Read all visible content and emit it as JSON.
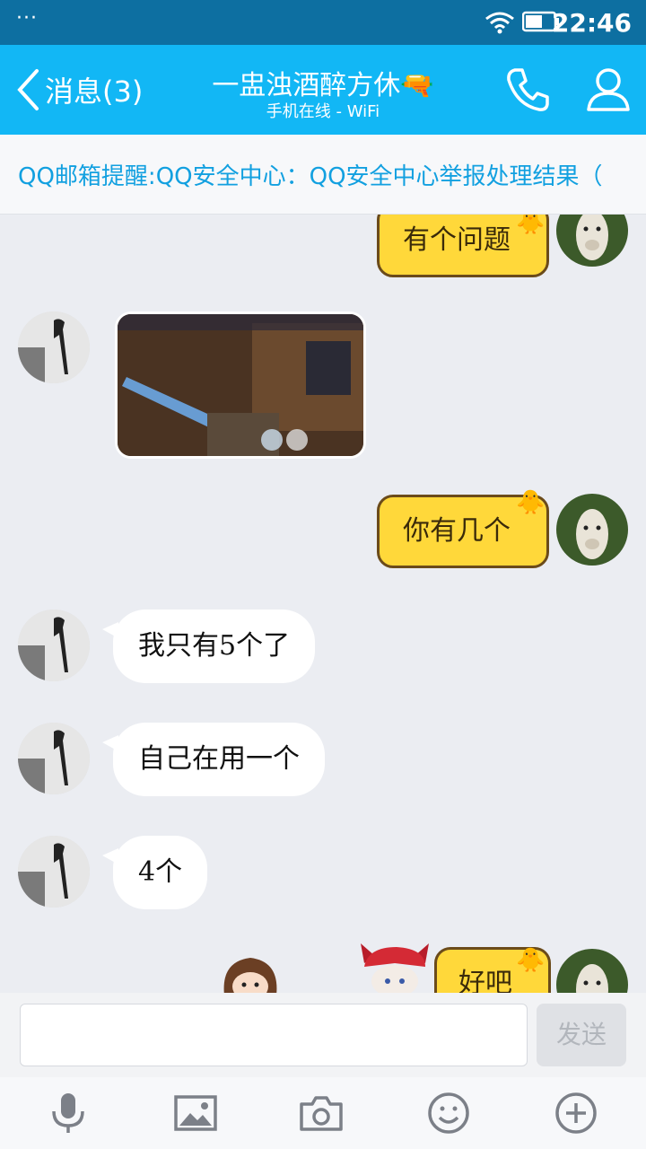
{
  "status": {
    "dots": "···",
    "time": "22:46"
  },
  "header": {
    "back_label": "消息(3)",
    "title": "一盅浊酒醉方休🔫",
    "subtitle": "手机在线 - WiFi"
  },
  "notice": {
    "text": "QQ邮箱提醒:QQ安全中心：QQ安全中心举报处理结果（"
  },
  "messages": [
    {
      "from": "me",
      "text": "有个问题"
    },
    {
      "from": "friend",
      "type": "image"
    },
    {
      "from": "me",
      "text": "你有几个"
    },
    {
      "from": "friend",
      "text": "我只有5个了"
    },
    {
      "from": "friend",
      "text": "自己在用一个"
    },
    {
      "from": "friend",
      "text": "4个"
    },
    {
      "from": "me",
      "text": "好吧"
    }
  ],
  "input": {
    "placeholder": "",
    "send_label": "发送"
  },
  "toolbar": [
    "microphone-icon",
    "image-icon",
    "camera-icon",
    "emoji-icon",
    "plus-icon"
  ],
  "colors": {
    "header": "#12b7f5",
    "statusbar": "#0d6fa1",
    "bubble_out": "#ffd83a",
    "notice_text": "#12a0e0"
  }
}
